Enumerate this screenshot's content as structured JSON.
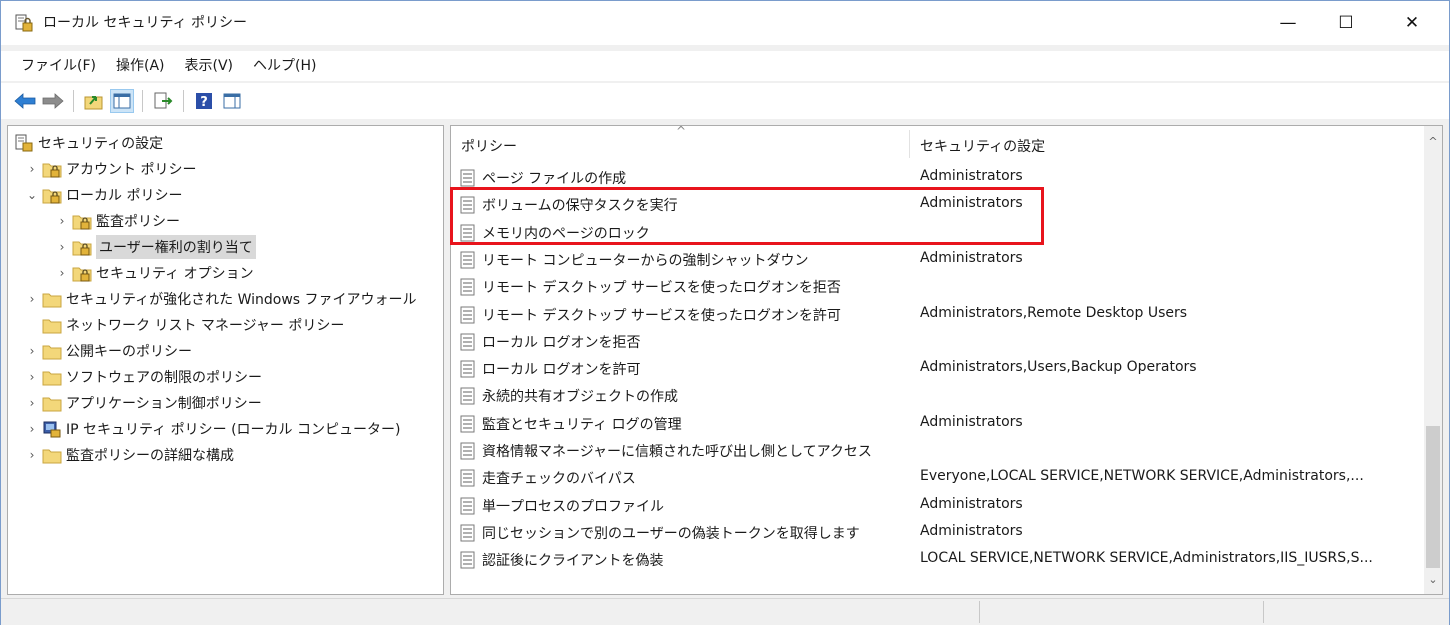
{
  "window": {
    "title": "ローカル セキュリティ ポリシー",
    "minimize_glyph": "—",
    "maximize_glyph": "☐",
    "close_glyph": "✕"
  },
  "menu": [
    "ファイル(F)",
    "操作(A)",
    "表示(V)",
    "ヘルプ(H)"
  ],
  "toolbar": [
    "back-icon",
    "forward-icon",
    "up-folder-icon",
    "show-hide-tree-icon",
    "export-list-icon",
    "help-icon",
    "show-action-pane-icon"
  ],
  "tree": {
    "root": "セキュリティの設定",
    "items": [
      {
        "label": "アカウント ポリシー",
        "expander": "›"
      },
      {
        "label": "ローカル ポリシー",
        "expander": "⌄"
      },
      {
        "label": "監査ポリシー",
        "expander": "›"
      },
      {
        "label": "ユーザー権利の割り当て",
        "expander": "›"
      },
      {
        "label": "セキュリティ オプション",
        "expander": "›"
      },
      {
        "label": "セキュリティが強化された Windows ファイアウォール",
        "expander": "›"
      },
      {
        "label": "ネットワーク リスト マネージャー ポリシー",
        "expander": ""
      },
      {
        "label": "公開キーのポリシー",
        "expander": "›"
      },
      {
        "label": "ソフトウェアの制限のポリシー",
        "expander": "›"
      },
      {
        "label": "アプリケーション制御ポリシー",
        "expander": "›"
      },
      {
        "label": "IP セキュリティ ポリシー (ローカル コンピューター)",
        "expander": "›"
      },
      {
        "label": "監査ポリシーの詳細な構成",
        "expander": "›"
      }
    ]
  },
  "list": {
    "columns": {
      "policy": "ポリシー",
      "setting": "セキュリティの設定"
    },
    "sort_glyph": "^",
    "rows": [
      {
        "policy": "ページ ファイルの作成",
        "setting": "Administrators"
      },
      {
        "policy": "ボリュームの保守タスクを実行",
        "setting": "Administrators"
      },
      {
        "policy": "メモリ内のページのロック",
        "setting": ""
      },
      {
        "policy": "リモート コンピューターからの強制シャットダウン",
        "setting": "Administrators"
      },
      {
        "policy": "リモート デスクトップ サービスを使ったログオンを拒否",
        "setting": ""
      },
      {
        "policy": "リモート デスクトップ サービスを使ったログオンを許可",
        "setting": "Administrators,Remote Desktop Users"
      },
      {
        "policy": "ローカル ログオンを拒否",
        "setting": ""
      },
      {
        "policy": "ローカル ログオンを許可",
        "setting": "Administrators,Users,Backup Operators"
      },
      {
        "policy": "永続的共有オブジェクトの作成",
        "setting": ""
      },
      {
        "policy": "監査とセキュリティ ログの管理",
        "setting": "Administrators"
      },
      {
        "policy": "資格情報マネージャーに信頼された呼び出し側としてアクセス",
        "setting": ""
      },
      {
        "policy": "走査チェックのバイパス",
        "setting": "Everyone,LOCAL SERVICE,NETWORK SERVICE,Administrators,..."
      },
      {
        "policy": "単一プロセスのプロファイル",
        "setting": "Administrators"
      },
      {
        "policy": "同じセッションで別のユーザーの偽装トークンを取得します",
        "setting": "Administrators"
      },
      {
        "policy": "認証後にクライアントを偽装",
        "setting": "LOCAL SERVICE,NETWORK SERVICE,Administrators,IIS_IUSRS,S..."
      }
    ]
  },
  "scrollbar": {
    "up_glyph": "^",
    "down_glyph": "⌄"
  },
  "colors": {
    "highlight": "#e8141c",
    "selection": "#d9d9d9",
    "folder": "#f3d77a",
    "toolbar_active": "#cce4f7"
  }
}
